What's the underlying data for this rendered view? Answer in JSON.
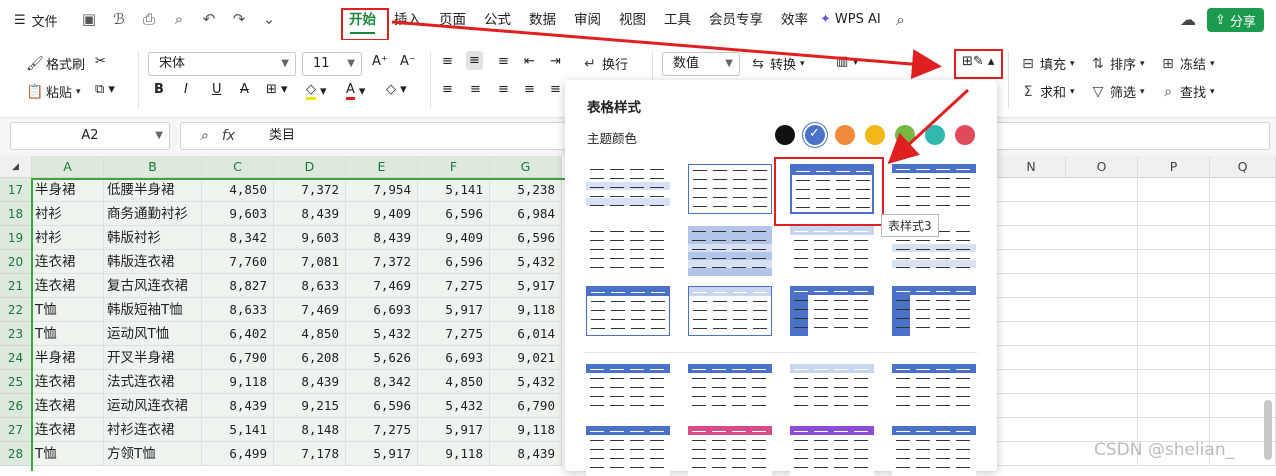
{
  "menu": {
    "file": "文件",
    "tabs": [
      "开始",
      "插入",
      "页面",
      "公式",
      "数据",
      "审阅",
      "视图",
      "工具",
      "会员专享",
      "效率"
    ],
    "wps_ai": "WPS AI",
    "share": "分享"
  },
  "ribbon": {
    "format_painter": "格式刷",
    "paste": "粘贴",
    "font_name": "宋体",
    "font_size": "11",
    "wrap": "换行",
    "number_format": "数值",
    "convert": "转换",
    "fill": "填充",
    "sort": "排序",
    "freeze": "冻结",
    "sum": "求和",
    "filter": "筛选",
    "find": "查找"
  },
  "formula_bar": {
    "cell_ref": "A2",
    "fx": "fx",
    "content": "类目"
  },
  "columns": [
    "A",
    "B",
    "C",
    "D",
    "E",
    "F",
    "G",
    "",
    "",
    "",
    "",
    "N",
    "O",
    "P",
    "Q"
  ],
  "rows": [
    {
      "n": "17",
      "a": "半身裙",
      "b": "低腰半身裙",
      "c": "4,850",
      "d": "7,372",
      "e": "7,954",
      "f": "5,141",
      "g": "5,238"
    },
    {
      "n": "18",
      "a": "衬衫",
      "b": "商务通勤衬衫",
      "c": "9,603",
      "d": "8,439",
      "e": "9,409",
      "f": "6,596",
      "g": "6,984"
    },
    {
      "n": "19",
      "a": "衬衫",
      "b": "韩版衬衫",
      "c": "8,342",
      "d": "9,603",
      "e": "8,439",
      "f": "9,409",
      "g": "6,596"
    },
    {
      "n": "20",
      "a": "连衣裙",
      "b": "韩版连衣裙",
      "c": "7,760",
      "d": "7,081",
      "e": "7,372",
      "f": "6,596",
      "g": "5,432"
    },
    {
      "n": "21",
      "a": "连衣裙",
      "b": "复古风连衣裙",
      "c": "8,827",
      "d": "8,633",
      "e": "7,469",
      "f": "7,275",
      "g": "5,917"
    },
    {
      "n": "22",
      "a": "T恤",
      "b": "韩版短袖T恤",
      "c": "8,633",
      "d": "7,469",
      "e": "6,693",
      "f": "5,917",
      "g": "9,118"
    },
    {
      "n": "23",
      "a": "T恤",
      "b": "运动风T恤",
      "c": "6,402",
      "d": "4,850",
      "e": "5,432",
      "f": "7,275",
      "g": "6,014"
    },
    {
      "n": "24",
      "a": "半身裙",
      "b": "开叉半身裙",
      "c": "6,790",
      "d": "6,208",
      "e": "5,626",
      "f": "6,693",
      "g": "9,021"
    },
    {
      "n": "25",
      "a": "连衣裙",
      "b": "法式连衣裙",
      "c": "9,118",
      "d": "8,439",
      "e": "8,342",
      "f": "4,850",
      "g": "5,432"
    },
    {
      "n": "26",
      "a": "连衣裙",
      "b": "运动风连衣裙",
      "c": "8,439",
      "d": "9,215",
      "e": "6,596",
      "f": "5,432",
      "g": "6,790"
    },
    {
      "n": "27",
      "a": "连衣裙",
      "b": "衬衫连衣裙",
      "c": "5,141",
      "d": "8,148",
      "e": "7,275",
      "f": "5,917",
      "g": "9,118"
    },
    {
      "n": "28",
      "a": "T恤",
      "b": "方领T恤",
      "c": "6,499",
      "d": "7,178",
      "e": "5,917",
      "f": "9,118",
      "g": "8,439"
    }
  ],
  "panel": {
    "title": "表格样式",
    "theme_label": "主题颜色",
    "tooltip": "表样式3",
    "theme_colors": [
      "#111111",
      "#4a72c9",
      "#ee8a3a",
      "#f2b817",
      "#77b943",
      "#33b8b0",
      "#e04a5a"
    ]
  },
  "watermark": "CSDN @shelian_"
}
